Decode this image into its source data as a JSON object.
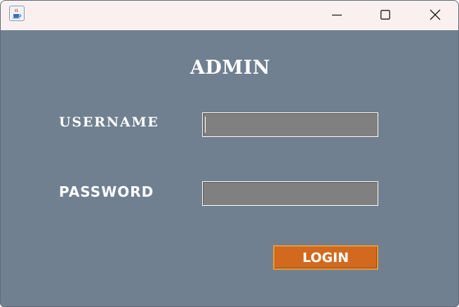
{
  "window": {
    "title": "",
    "app_icon": "java-coffee-cup-icon",
    "controls": {
      "minimize_icon": "minimize-icon",
      "maximize_icon": "maximize-icon",
      "close_icon": "close-icon"
    },
    "background_color": "#708090",
    "titlebar_color": "#f9f0ef"
  },
  "form": {
    "heading": "ADMIN",
    "username_label": "USERNAME",
    "username_value": "",
    "password_label": "PASSWORD",
    "password_value": "",
    "login_label": "LOGIN",
    "field_color": "#808080",
    "button_color": "#d2691e"
  }
}
